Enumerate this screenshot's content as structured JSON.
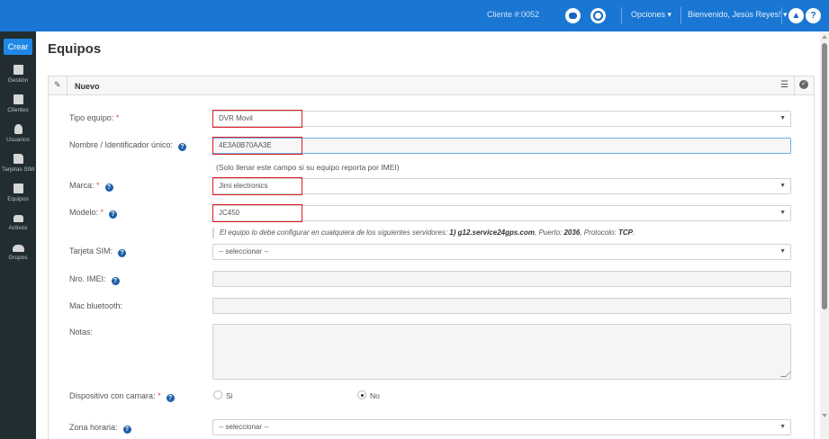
{
  "topbar": {
    "cliente": "Cliente #:0052",
    "opciones": "Opciones ▾",
    "user": "Bienvenido, Jesús Reyes! ▾"
  },
  "sidebar": {
    "crear": "Crear",
    "items": [
      {
        "label": "Gestión",
        "icon": "gestion-icon"
      },
      {
        "label": "Clientes",
        "icon": "clientes-icon"
      },
      {
        "label": "Usuarios",
        "icon": "user-icon"
      },
      {
        "label": "Tarjetas SIM",
        "icon": "sim-card-icon"
      },
      {
        "label": "Equipos",
        "icon": "equipos-icon"
      },
      {
        "label": "Activos",
        "icon": "car-icon"
      },
      {
        "label": "Grupos",
        "icon": "group-icon"
      }
    ]
  },
  "page": {
    "title": "Equipos",
    "panel_title": "Nuevo"
  },
  "form": {
    "tipo_equipo": {
      "label": "Tipo equipo:",
      "value": "DVR Movil"
    },
    "nombre": {
      "label": "Nombre / Identificador único:",
      "value": "4E3A0B70AA3E",
      "hint": "(Solo llenar este campo si su equipo reporta por IMEI)"
    },
    "marca": {
      "label": "Marca:",
      "value": "Jimi electronics"
    },
    "modelo": {
      "label": "Modelo:",
      "value": "JC450"
    },
    "info": {
      "prefix": "El equipo lo debe configurar en cualquiera de los siguientes servidores:",
      "server": "1) g12.service24gps.com",
      "puerto_label": ", Puerto:",
      "puerto": "2036",
      "protocolo_label": ", Protocolo:",
      "protocolo": "TCP",
      "end": "."
    },
    "tarjeta_sim": {
      "label": "Tarjeta SIM:",
      "value": "-- seleccionar --"
    },
    "imei": {
      "label": "Nro. IMEI:",
      "value": ""
    },
    "bluetooth": {
      "label": "Mac bluetooth:",
      "value": ""
    },
    "notas": {
      "label": "Notas:",
      "value": ""
    },
    "camara": {
      "label": "Dispositivo con camara:",
      "opt_si": "Si",
      "opt_no": "No",
      "selected": "No"
    },
    "zona": {
      "label": "Zona horaria:",
      "value": "-- seleccionar --"
    },
    "required_mark": "*"
  }
}
